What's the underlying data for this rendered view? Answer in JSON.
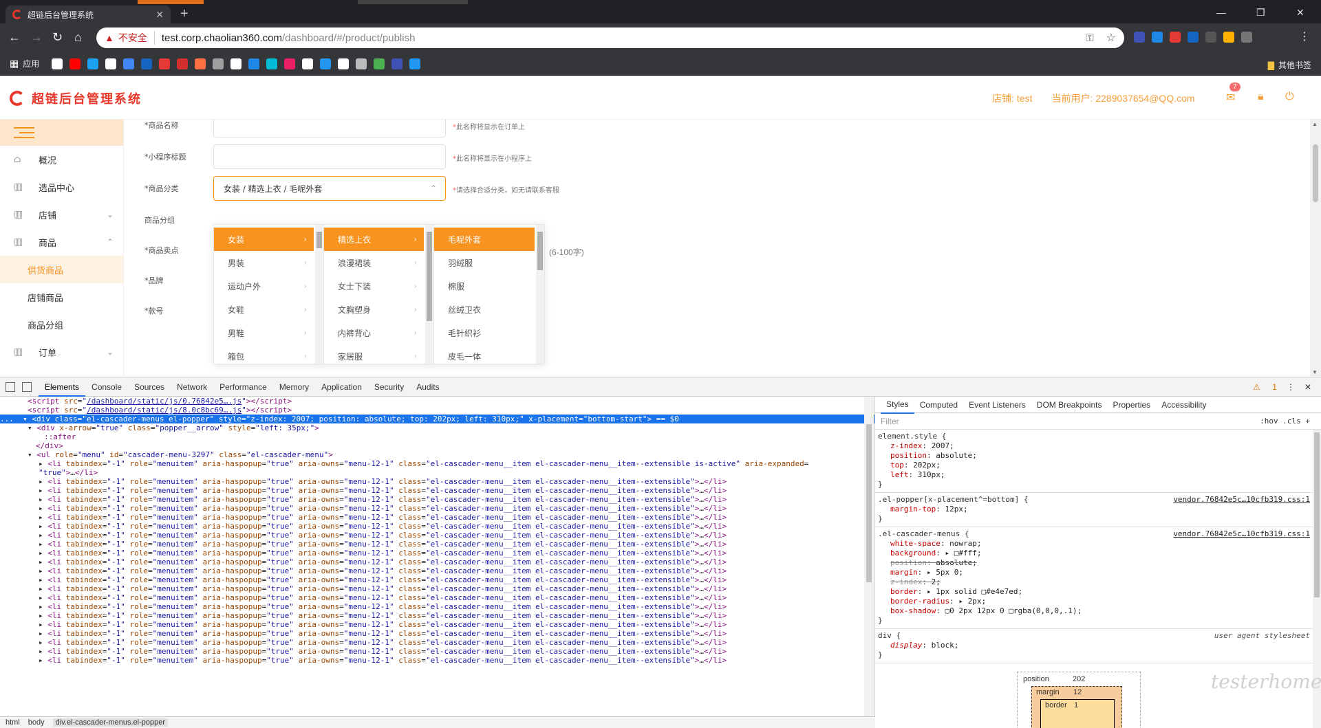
{
  "browser": {
    "tab_title": "超链后台管理系统",
    "new_tab": "+",
    "window_controls": [
      "—",
      "❐",
      "✕"
    ],
    "omnibox": {
      "security_label": "不安全",
      "host": "test.corp.chaolian360.com",
      "path": "/dashboard/#/product/publish"
    },
    "bookmarks": {
      "apps_label": "应用",
      "other_label": "其他书签",
      "icon_colors": [
        "#ffffff",
        "#ff0000",
        "#1da1f2",
        "#ffffff",
        "#4285f4",
        "#1565c0",
        "#e53935",
        "#d32f2f",
        "#ff7043",
        "#9e9e9e",
        "#ffffff",
        "#1e88e5",
        "#00bcd4",
        "#e91e63",
        "#ffffff",
        "#2196f3",
        "#ffffff",
        "#bbbbbb",
        "#4caf50",
        "#3f51b5",
        "#2196f3"
      ]
    },
    "extension_colors": [
      "#3f51b5",
      "#1e88e5",
      "#e53935",
      "#1565c0",
      "#555555",
      "#ffb300",
      "#757575"
    ]
  },
  "app": {
    "title": "超链后台管理系统",
    "brand_color": "#e8372b",
    "accent_color": "#f7931e",
    "header": {
      "shop_label": "店铺:",
      "shop_value": "test",
      "user_label": "当前用户:",
      "user_value": "2289037654@QQ.com",
      "message_badge": "7"
    },
    "sidebar": {
      "items": [
        {
          "label": "概况",
          "icon": "home-icon",
          "has_chevron": false
        },
        {
          "label": "选品中心",
          "icon": "library-icon",
          "has_chevron": false
        },
        {
          "label": "店铺",
          "icon": "library-icon",
          "has_chevron": true,
          "chevron": "⌄"
        },
        {
          "label": "商品",
          "icon": "library-icon",
          "has_chevron": true,
          "chevron": "⌃"
        }
      ],
      "sub_items": [
        "供货商品",
        "店铺商品",
        "商品分组"
      ],
      "active_sub": "供货商品",
      "after_items": [
        {
          "label": "订单",
          "icon": "library-icon",
          "chevron": "⌄"
        }
      ]
    },
    "form": {
      "fields": [
        {
          "label": "*商品名称",
          "hint": "此名称将显示在订单上",
          "hint_star": "*"
        },
        {
          "label": "*小程序标题",
          "hint": "此名称将显示在小程序上",
          "hint_star": "*"
        },
        {
          "label": "*商品分类",
          "value": "女装 / 精选上衣 / 毛呢外套",
          "hint": "请选择合适分类，如无请联系客服",
          "hint_star": "*"
        },
        {
          "label": "商品分组"
        },
        {
          "label": "*商品卖点",
          "hint": "(6-100字)"
        },
        {
          "label": "*品牌"
        },
        {
          "label": "*款号"
        }
      ]
    },
    "cascader": {
      "columns": [
        {
          "items": [
            "女装",
            "男装",
            "运动户外",
            "女鞋",
            "男鞋",
            "箱包"
          ],
          "active": 0
        },
        {
          "items": [
            "精选上衣",
            "浪漫裙装",
            "女士下装",
            "文胸塑身",
            "内裤背心",
            "家居服"
          ],
          "active": 0
        },
        {
          "items": [
            "毛呢外套",
            "羽绒服",
            "棉服",
            "丝绒卫衣",
            "毛针织衫",
            "皮毛一体"
          ],
          "active": 0
        }
      ]
    }
  },
  "devtools": {
    "tabs": [
      "Elements",
      "Console",
      "Sources",
      "Network",
      "Performance",
      "Memory",
      "Application",
      "Security",
      "Audits"
    ],
    "active_tab": "Elements",
    "warning_count": "1",
    "code_lines": {
      "script1_src": "/dashboard/static/js/0.76842e5….js",
      "script2_src": "/dashboard/static/js/8.0c8bc69….js",
      "selected_div_class": "el-cascader-menus el-popper",
      "selected_div_style": "z-index: 2007; position: absolute; top: 202px; left: 310px;",
      "selected_div_placement": "bottom-start",
      "selected_marker": "== $0",
      "arrow_style": "left: 35px;",
      "ul_id": "cascader-menu-3297",
      "menu_owns": "menu-12-1",
      "first_li_class": "el-cascader-menu__item el-cascader-menu__item--extensible is-active",
      "li_class": "el-cascader-menu__item el-cascader-menu__item--extensible",
      "li_repeat_count": 21
    },
    "breadcrumbs": [
      "html",
      "body",
      "div.el-cascader-menus.el-popper"
    ],
    "styles": {
      "tabs": [
        "Styles",
        "Computed",
        "Event Listeners",
        "DOM Breakpoints",
        "Properties",
        "Accessibility"
      ],
      "active_tab": "Styles",
      "filter_placeholder": "Filter",
      "filter_right": ":hov  .cls  +",
      "rules": [
        {
          "selector": "element.style {",
          "source": "",
          "props": [
            {
              "name": "z-index",
              "value": "2007;"
            },
            {
              "name": "position",
              "value": "absolute;"
            },
            {
              "name": "top",
              "value": "202px;"
            },
            {
              "name": "left",
              "value": "310px;"
            }
          ]
        },
        {
          "selector": ".el-popper[x-placement^=bottom] {",
          "source": "vendor.76842e5c…10cfb319.css:1",
          "props": [
            {
              "name": "margin-top",
              "value": "12px;"
            }
          ]
        },
        {
          "selector": ".el-cascader-menus {",
          "source": "vendor.76842e5c…10cfb319.css:1",
          "props": [
            {
              "name": "white-space",
              "value": "nowrap;"
            },
            {
              "name": "background",
              "value": "▸ □#fff;"
            },
            {
              "name": "position",
              "value": "absolute;",
              "struck": true
            },
            {
              "name": "margin",
              "value": "▸ 5px 0;"
            },
            {
              "name": "z-index",
              "value": "2;",
              "struck": true
            },
            {
              "name": "border",
              "value": "▸ 1px solid □#e4e7ed;"
            },
            {
              "name": "border-radius",
              "value": "▸ 2px;"
            },
            {
              "name": "box-shadow",
              "value": "▢0 2px 12px 0 □rgba(0,0,0,.1);"
            }
          ]
        },
        {
          "selector": "div {",
          "source": "user agent stylesheet",
          "ua": true,
          "props": [
            {
              "name": "display",
              "value": "block;"
            }
          ]
        }
      ],
      "box_model": {
        "position_label": "position",
        "position_value": "202",
        "margin_label": "margin",
        "margin_value": "12",
        "border_label": "border",
        "border_value": "1"
      }
    },
    "watermark": "testerhome.com"
  }
}
